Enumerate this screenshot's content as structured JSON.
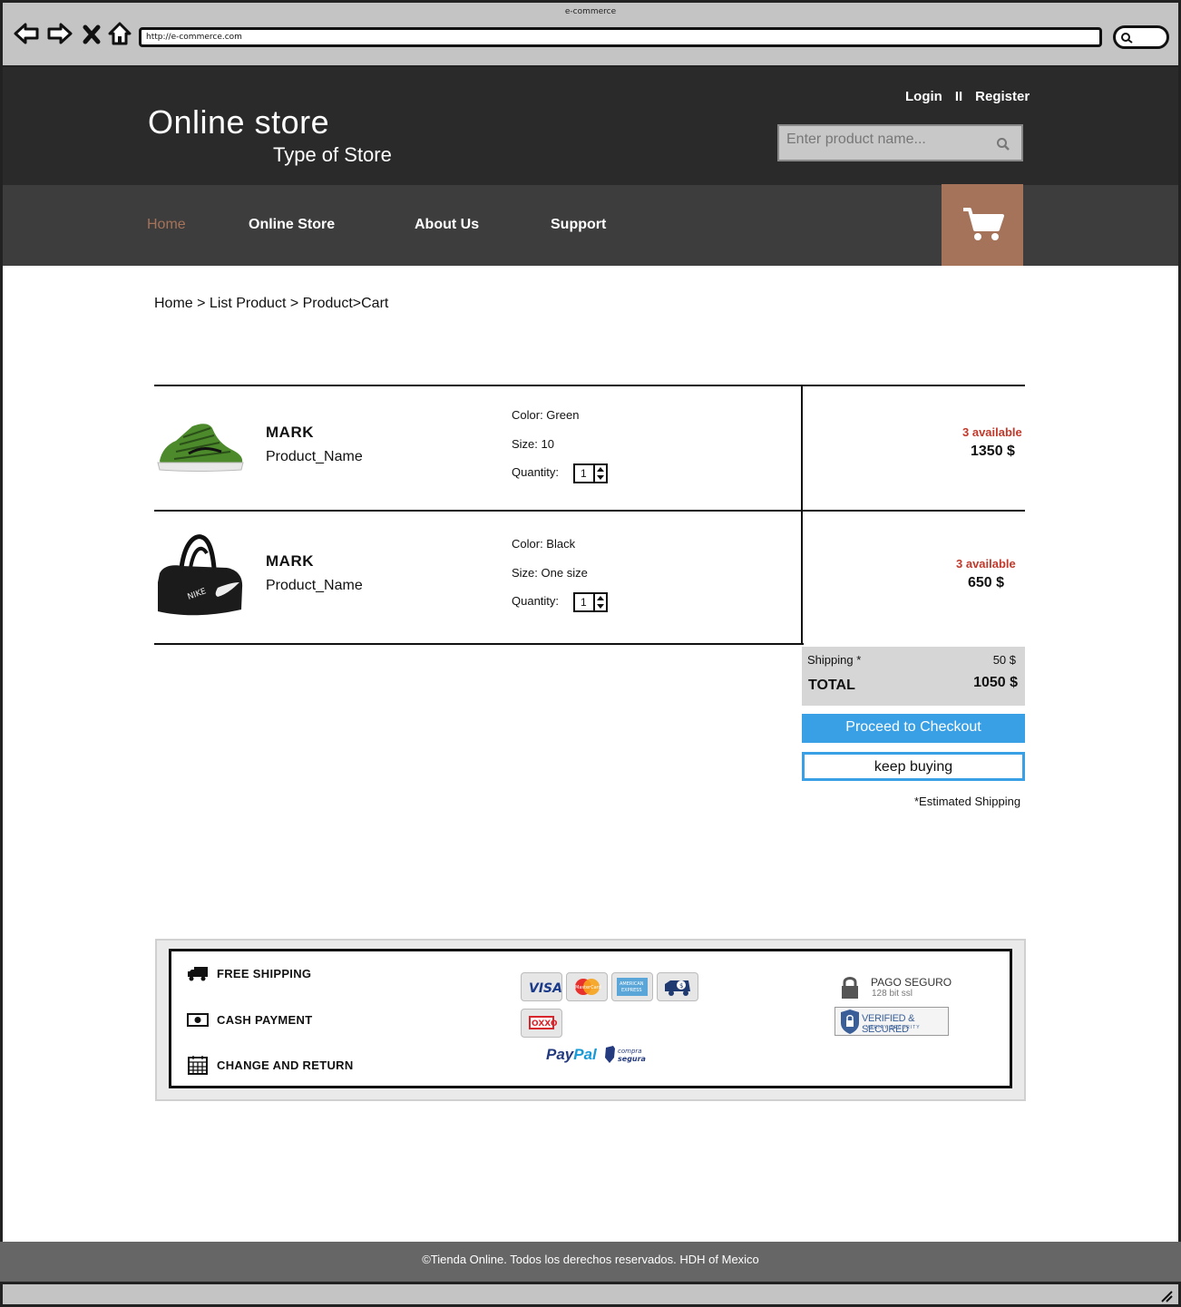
{
  "browser": {
    "window_title": "e-commerce",
    "url": "http://e-commerce.com"
  },
  "header": {
    "store_title": "Online store",
    "store_subtitle": "Type of Store",
    "login": "Login",
    "separator": "II",
    "register": "Register",
    "search_placeholder": "Enter product name..."
  },
  "nav": {
    "items": [
      {
        "label": "Home",
        "active": true
      },
      {
        "label": "Online Store",
        "active": false
      },
      {
        "label": "About Us",
        "active": false
      },
      {
        "label": "Support",
        "active": false
      }
    ],
    "cart_icon": "shopping-cart-icon"
  },
  "breadcrumb": "Home > List Product > Product>Cart",
  "cart": {
    "items": [
      {
        "brand": "MARK",
        "name": "Product_Name",
        "color": "Color: Green",
        "size": "Size: 10",
        "quantity_label": "Quantity:",
        "quantity": "1",
        "availability": "3 available",
        "price": "1350 $",
        "image": "green-sneaker"
      },
      {
        "brand": "MARK",
        "name": "Product_Name",
        "color": "Color: Black",
        "size": "Size: One size",
        "quantity_label": "Quantity:",
        "quantity": "1",
        "availability": "3 available",
        "price": "650 $",
        "image": "black-duffel-bag"
      }
    ],
    "shipping_label": "Shipping *",
    "shipping_value": "50 $",
    "total_label": "TOTAL",
    "total_value": "1050 $",
    "checkout_label": "Proceed to Checkout",
    "keep_buying_label": "keep buying",
    "shipping_note": "*Estimated Shipping"
  },
  "info": {
    "features": [
      {
        "label": "FREE SHIPPING",
        "icon": "truck-icon"
      },
      {
        "label": "CASH PAYMENT",
        "icon": "cash-icon"
      },
      {
        "label": "CHANGE AND RETURN",
        "icon": "calendar-icon"
      }
    ],
    "payment_methods": [
      "VISA",
      "MasterCard",
      "AMERICAN EXPRESS",
      "delivery-cash",
      "OXXO"
    ],
    "paypal_1": "Pay",
    "paypal_2": "Pal",
    "compra_segura": "compra segura",
    "secure_title": "PAGO SEGURO",
    "secure_sub": "128 bit ssl",
    "verified_label": "VERIFIED & SECURED",
    "verified_sub": "VERIFY SECURITY"
  },
  "footer": {
    "copyright": "©Tienda Online. Todos los derechos reservados. HDH of Mexico"
  },
  "colors": {
    "header_bg": "#2a2a2a",
    "nav_bg": "#3d3d3d",
    "accent_brown": "#a5735a",
    "checkout_blue": "#3aa0e6",
    "available_red": "#c0392b"
  }
}
